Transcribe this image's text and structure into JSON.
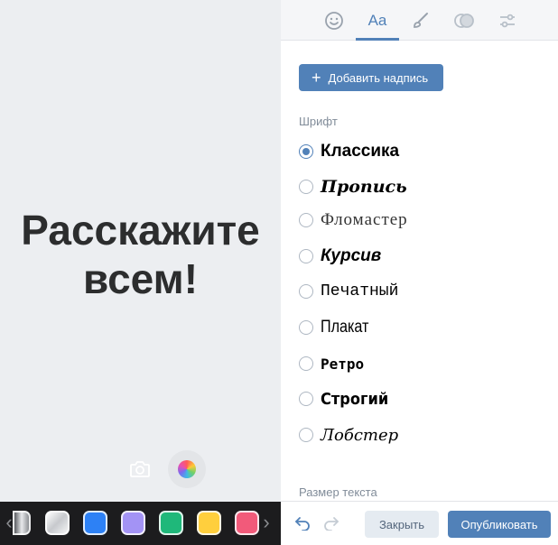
{
  "preview": {
    "story_line1": "Расскажите",
    "story_line2": "всем!",
    "camera_icon": "camera-icon",
    "palette_icon": "color-wheel-icon",
    "background": "#eceef1"
  },
  "color_strip": {
    "background": "#1c1c1e",
    "prev_arrow": "‹",
    "next_arrow": "›",
    "swatches": [
      {
        "name": "silver-gradient",
        "color": "#b9bcc0"
      },
      {
        "name": "white-gradient",
        "color": "#e8e9eb"
      },
      {
        "name": "blue",
        "color": "#2d81f5"
      },
      {
        "name": "lavender",
        "color": "#a393f5"
      },
      {
        "name": "green",
        "color": "#1fb87a"
      },
      {
        "name": "yellow",
        "color": "#ffcf3d"
      },
      {
        "name": "pink",
        "color": "#f25a7a"
      }
    ]
  },
  "tabs": {
    "items": [
      {
        "name": "stickers",
        "icon": "smiley-icon"
      },
      {
        "name": "text",
        "label": "Aa",
        "active": true
      },
      {
        "name": "drawing",
        "icon": "brush-icon"
      },
      {
        "name": "masks",
        "icon": "overlay-icon"
      },
      {
        "name": "settings",
        "icon": "sliders-icon"
      }
    ],
    "accent": "#5181b8"
  },
  "text_panel": {
    "add_button_label": "Добавить надпись",
    "font_section_label": "Шрифт",
    "fonts": [
      {
        "label": "Классика",
        "selected": true
      },
      {
        "label": "Пропись",
        "selected": false
      },
      {
        "label": "Фломастер",
        "selected": false
      },
      {
        "label": "Курсив",
        "selected": false
      },
      {
        "label": "Печатный",
        "selected": false
      },
      {
        "label": "Плакат",
        "selected": false
      },
      {
        "label": "Ретро",
        "selected": false
      },
      {
        "label": "Строгий",
        "selected": false
      },
      {
        "label": "Лобстер",
        "selected": false
      }
    ],
    "size_section_label": "Размер текста"
  },
  "footer": {
    "undo_icon": "undo-icon",
    "redo_icon": "redo-icon",
    "close_label": "Закрыть",
    "publish_label": "Опубликовать"
  }
}
